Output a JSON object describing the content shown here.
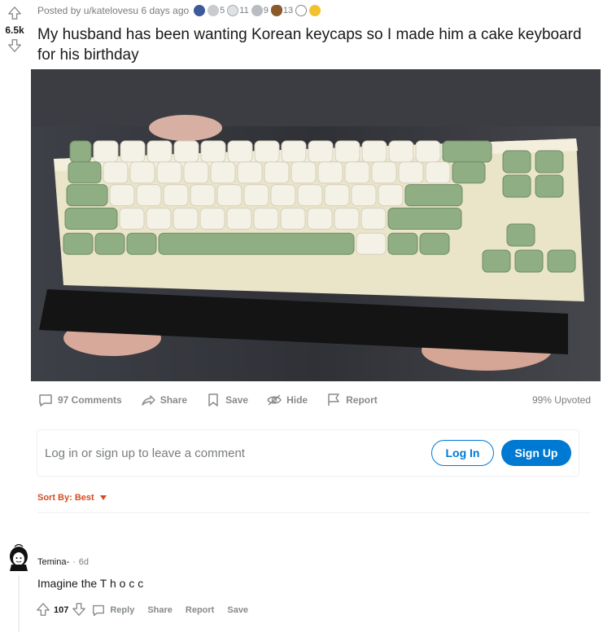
{
  "post": {
    "score": "6.5k",
    "posted_by_prefix": "Posted by",
    "author": "u/katelovesu",
    "age": "6 days ago",
    "title": "My husband has been wanting Korean keycaps so I made him a cake keyboard for his birthday",
    "upvoted": "99% Upvoted"
  },
  "awards": [
    {
      "icon": "helmet-award-icon",
      "count": ""
    },
    {
      "icon": "wholesome-award-icon",
      "count": "5"
    },
    {
      "icon": "silver-award-icon",
      "count": "11"
    },
    {
      "icon": "coin-award-icon",
      "count": "9"
    },
    {
      "icon": "poop-award-icon",
      "count": "13"
    },
    {
      "icon": "sun-award-icon",
      "count": ""
    },
    {
      "icon": "sun-face-award-icon",
      "count": ""
    }
  ],
  "actions": {
    "comments": "97 Comments",
    "share": "Share",
    "save": "Save",
    "hide": "Hide",
    "report": "Report"
  },
  "login": {
    "prompt": "Log in or sign up to leave a comment",
    "login_label": "Log In",
    "signup_label": "Sign Up"
  },
  "sort": {
    "label": "Sort By: Best"
  },
  "comment": {
    "author": "Temina-",
    "separator": "·",
    "age": "6d",
    "body": "Imagine the T h o c c",
    "score": "107",
    "reply": "Reply",
    "share": "Share",
    "report": "Report",
    "save": "Save"
  },
  "colors": {
    "accent_blue": "#0079d3",
    "sort_orange": "#d44d21",
    "keycap_green": "#8fae84",
    "keycap_cream": "#f4f1e6",
    "muted_text": "#787c7e"
  }
}
